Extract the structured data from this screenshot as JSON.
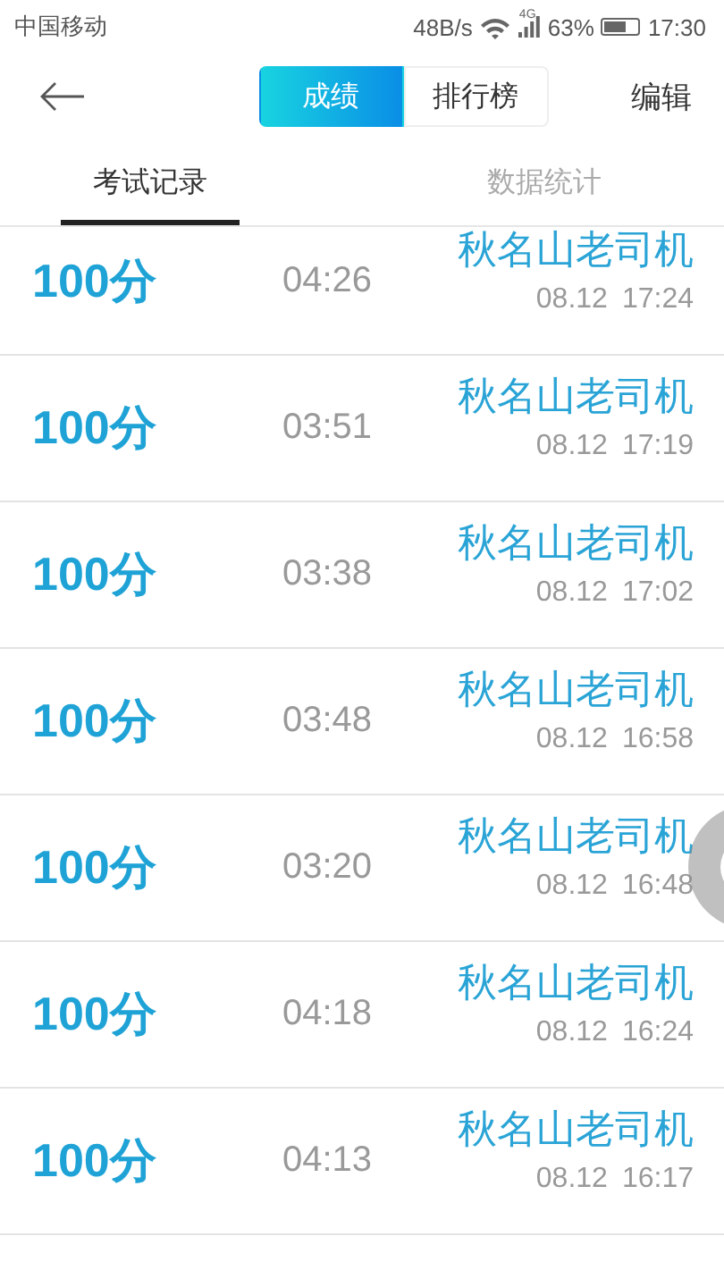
{
  "status_bar": {
    "carrier": "中国移动",
    "speed": "48B/s",
    "network": "4G",
    "battery": "63%",
    "time": "17:30"
  },
  "nav": {
    "segments": [
      {
        "label": "成绩",
        "selected": true
      },
      {
        "label": "排行榜",
        "selected": false
      }
    ],
    "action": "编辑"
  },
  "tabs": [
    {
      "label": "考试记录",
      "selected": true
    },
    {
      "label": "数据统计",
      "selected": false
    }
  ],
  "records": [
    {
      "score": "100分",
      "duration": "04:26",
      "name": "秋名山老司机",
      "date": "08.12",
      "time": "17:24"
    },
    {
      "score": "100分",
      "duration": "03:51",
      "name": "秋名山老司机",
      "date": "08.12",
      "time": "17:19"
    },
    {
      "score": "100分",
      "duration": "03:38",
      "name": "秋名山老司机",
      "date": "08.12",
      "time": "17:02"
    },
    {
      "score": "100分",
      "duration": "03:48",
      "name": "秋名山老司机",
      "date": "08.12",
      "time": "16:58"
    },
    {
      "score": "100分",
      "duration": "03:20",
      "name": "秋名山老司机",
      "date": "08.12",
      "time": "16:48"
    },
    {
      "score": "100分",
      "duration": "04:18",
      "name": "秋名山老司机",
      "date": "08.12",
      "time": "16:24"
    },
    {
      "score": "100分",
      "duration": "04:13",
      "name": "秋名山老司机",
      "date": "08.12",
      "time": "16:17"
    }
  ]
}
